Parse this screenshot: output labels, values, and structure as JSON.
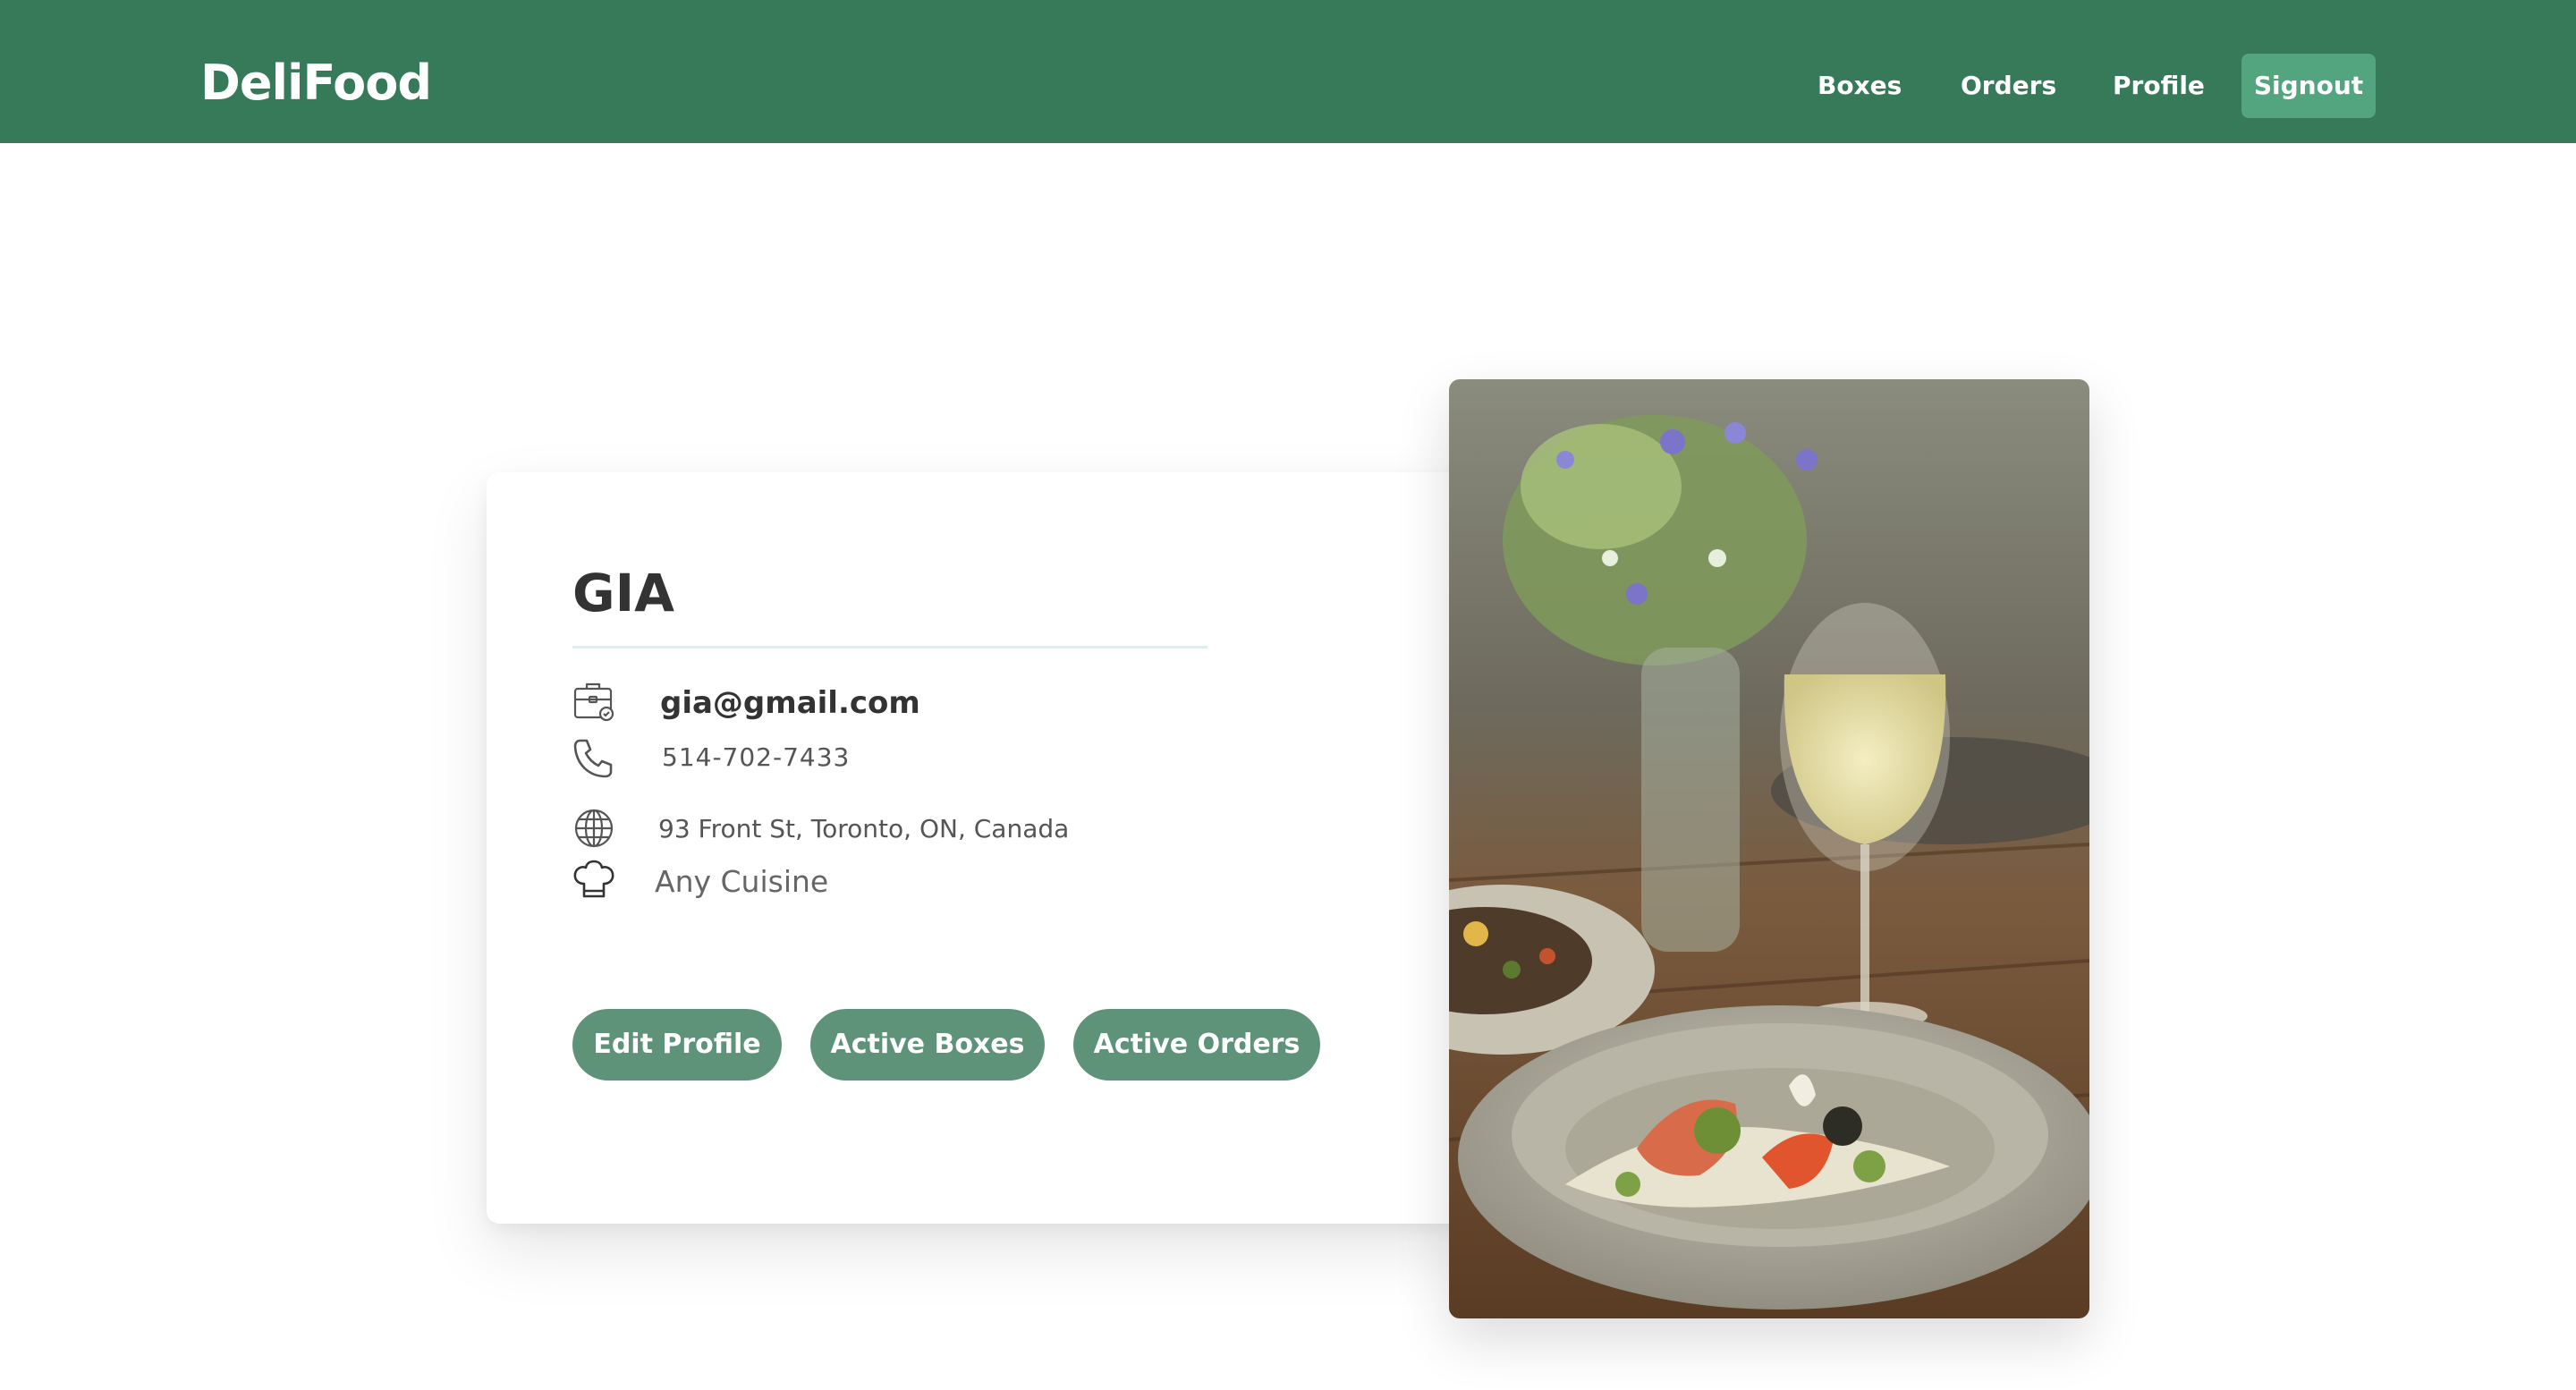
{
  "navbar": {
    "brand": "DeliFood",
    "links": [
      {
        "label": "Boxes"
      },
      {
        "label": "Orders"
      },
      {
        "label": "Profile"
      }
    ],
    "signout_label": "Signout",
    "background_color": "#367a5a",
    "signout_color": "#52a57f"
  },
  "profile": {
    "name": "GIA",
    "email": "gia@gmail.com",
    "phone": "514-702-7433",
    "address": "93 Front St, Toronto, ON, Canada",
    "cuisine": "Any Cuisine",
    "icons": {
      "email": "briefcase-icon",
      "phone": "phone-icon",
      "address": "globe-icon",
      "cuisine": "chef-hat-icon"
    }
  },
  "actions": {
    "edit_profile": "Edit Profile",
    "active_boxes": "Active Boxes",
    "active_orders": "Active Orders",
    "button_color": "#5e937a"
  },
  "hero_image": {
    "description_icon": "food-photo"
  }
}
